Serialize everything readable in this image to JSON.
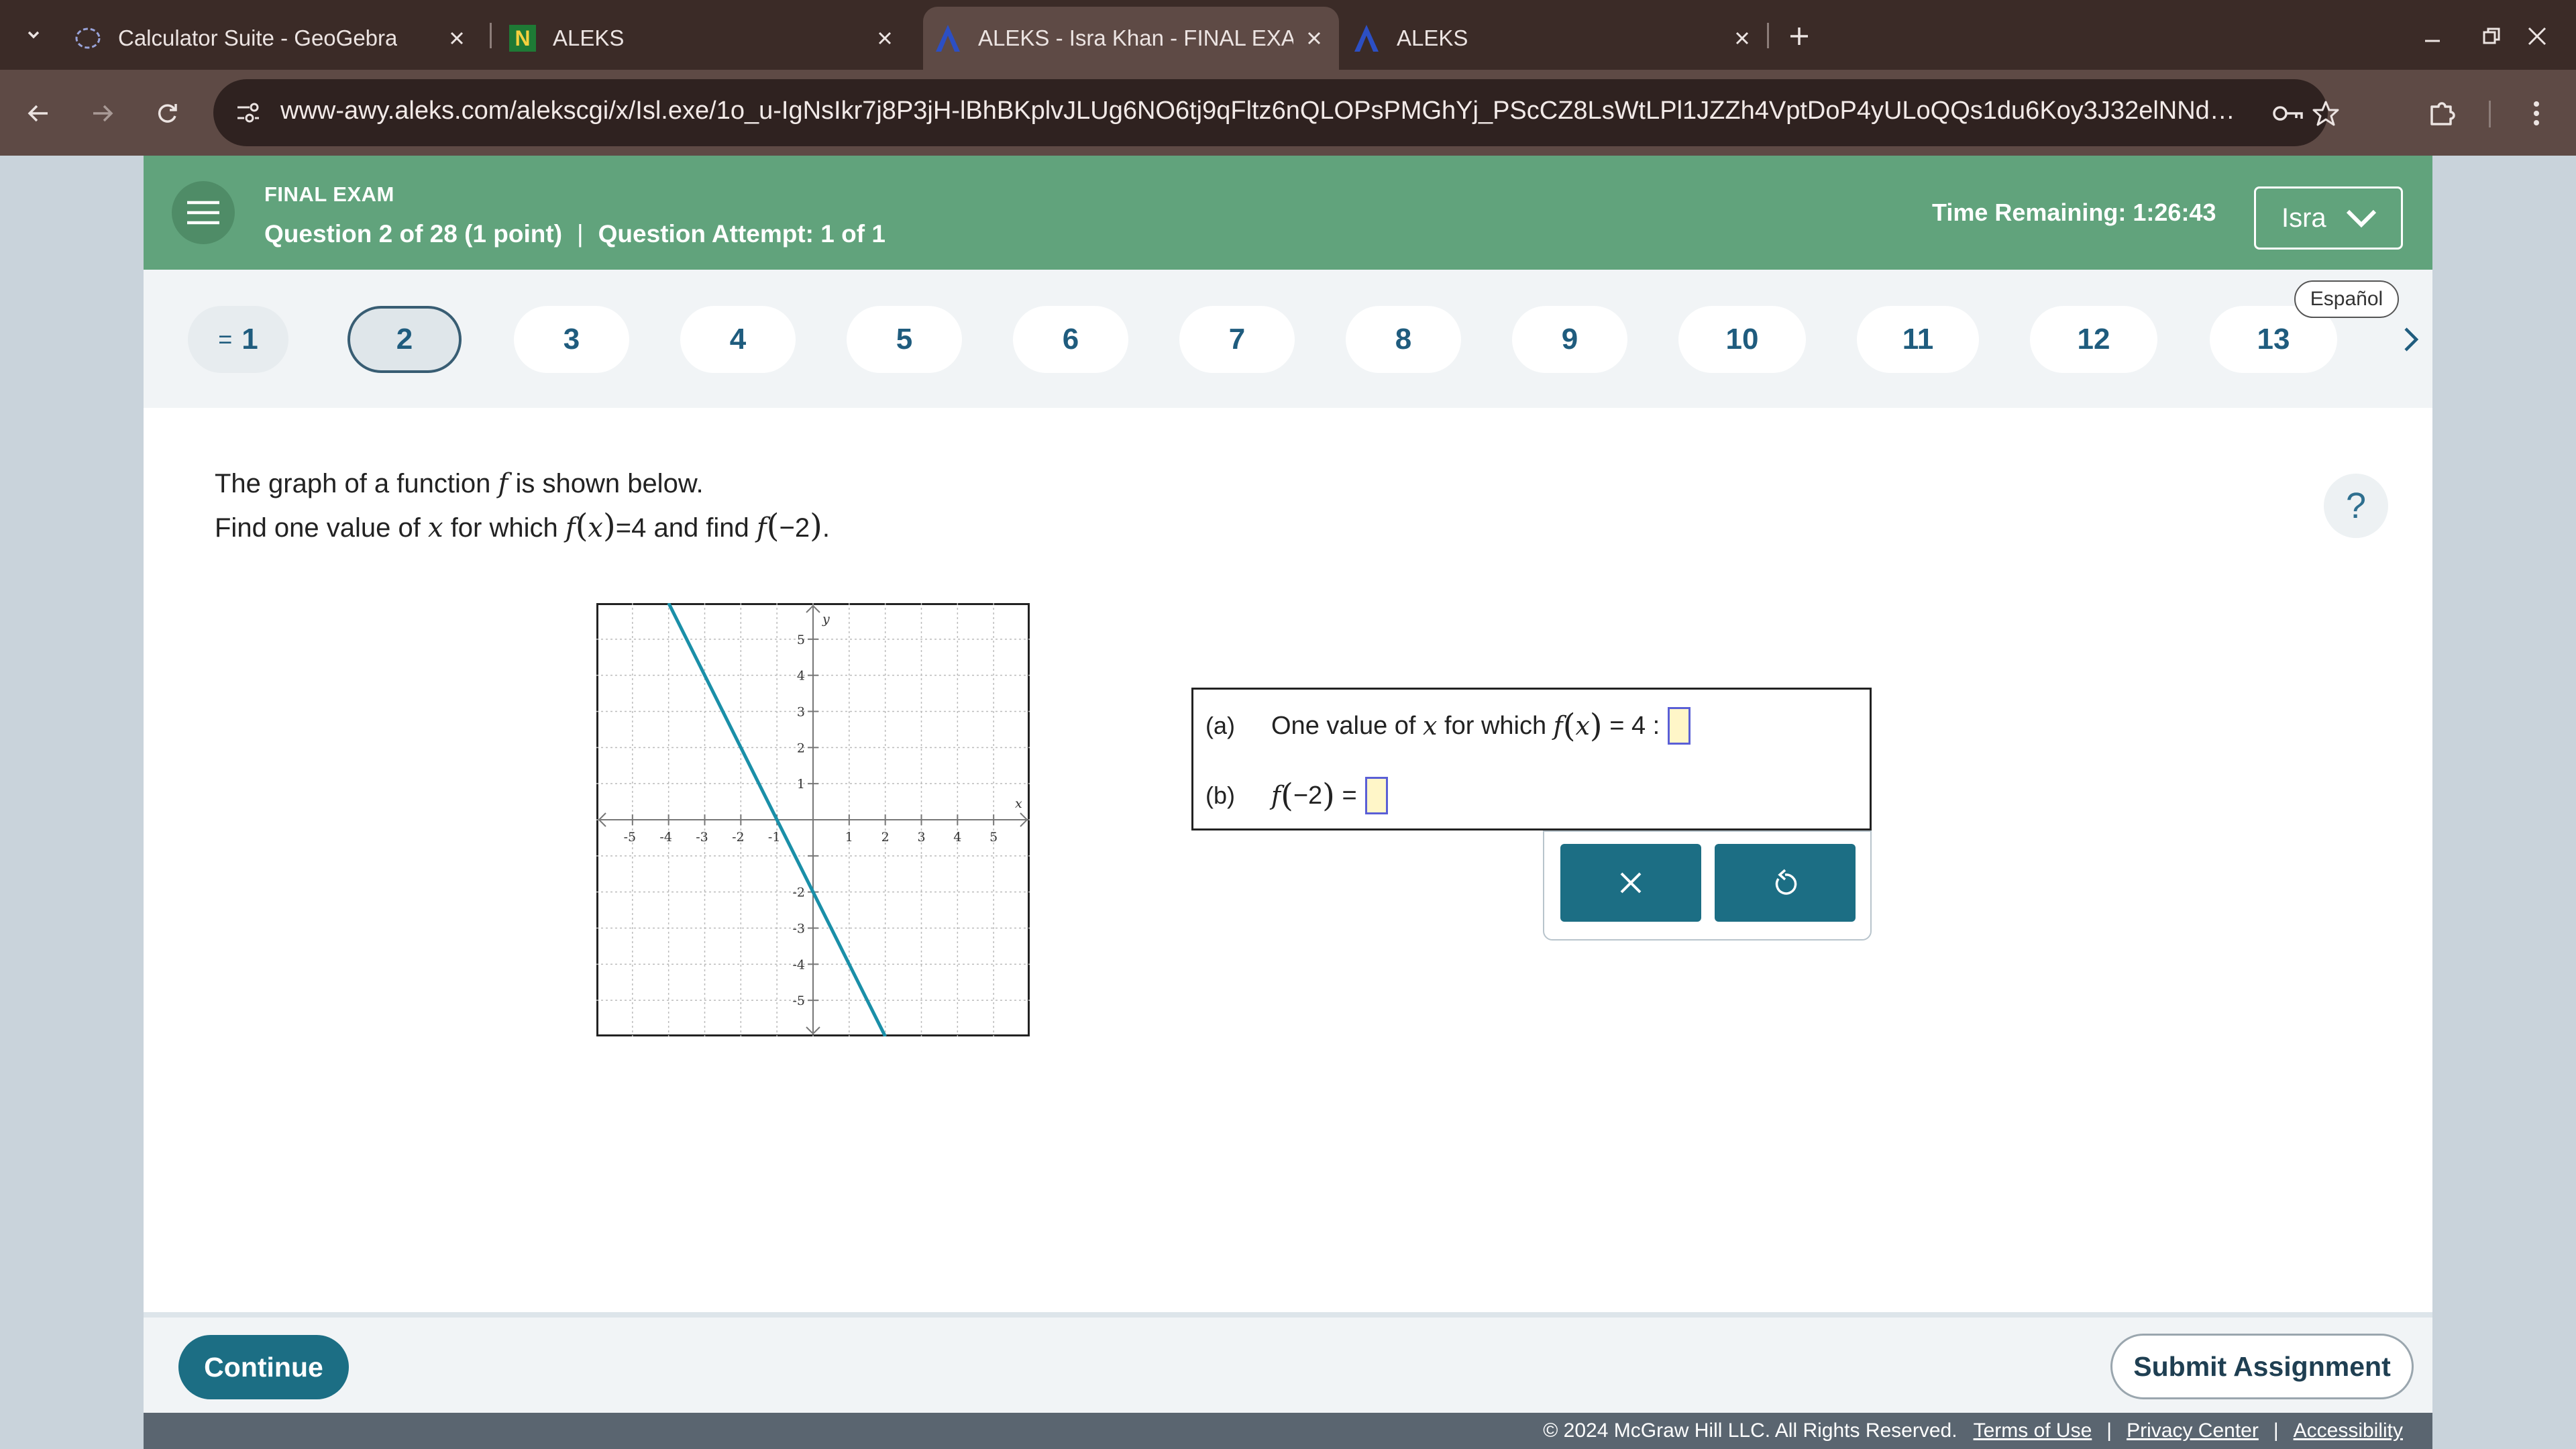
{
  "browser": {
    "tabs": [
      {
        "title": "Calculator Suite - GeoGebra",
        "icon": "geogebra-icon"
      },
      {
        "title": "ALEKS",
        "icon": "n-icon"
      },
      {
        "title": "ALEKS - Isra Khan - FINAL EXAM",
        "icon": "aleks-icon",
        "active": true
      },
      {
        "title": "ALEKS",
        "icon": "aleks-icon"
      }
    ],
    "url": "www-awy.aleks.com/alekscgi/x/Isl.exe/1o_u-IgNsIkr7j8P3jH-lBhBKplvJLUg6NO6tj9qFltz6nQLOPsPMGhYj_PScCZ8LsWtLPl1JZZh4VptDoP4yULoQQs1du6Koy3J32elNNd1bk4A..."
  },
  "header": {
    "title": "FINAL EXAM",
    "question_info": "Question 2 of 28 (1 point)",
    "attempt_info": "Question Attempt: 1 of 1",
    "separator": "|",
    "time_remaining": "Time Remaining: 1:26:43",
    "user": "Isra"
  },
  "qnav": {
    "items": [
      "1",
      "2",
      "3",
      "4",
      "5",
      "6",
      "7",
      "8",
      "9",
      "10",
      "11",
      "12",
      "13"
    ],
    "current": "2",
    "language_button": "Español"
  },
  "question": {
    "line1_a": "The graph of a function",
    "line1_b": "is shown below.",
    "line2_a": "Find one value of",
    "line2_b": "for which",
    "line2_c": "and find",
    "f": "f",
    "x": "x",
    "eq4": "=4",
    "neg2": "−2",
    "period": "."
  },
  "graph": {
    "x_label": "x",
    "y_label": "y",
    "x_ticks": [
      "-5",
      "-4",
      "-3",
      "-2",
      "-1",
      "1",
      "2",
      "3",
      "4",
      "5"
    ],
    "y_ticks": [
      "5",
      "4",
      "3",
      "2",
      "1",
      "-2",
      "-3",
      "-4",
      "-5"
    ],
    "xlim": [
      -6,
      6
    ],
    "ylim": [
      -6,
      6
    ],
    "line": {
      "slope": -2,
      "intercept": -2,
      "color": "#1a8fa8"
    }
  },
  "answers": {
    "a_label": "(a)",
    "a_text": "One value of",
    "a_for_which": "for which",
    "a_eq": "= 4 :",
    "b_label": "(b)",
    "b_neg2": "−2",
    "b_eq": "="
  },
  "footer": {
    "continue": "Continue",
    "submit": "Submit Assignment",
    "copyright": "© 2024 McGraw Hill LLC. All Rights Reserved.",
    "terms": "Terms of Use",
    "privacy": "Privacy Center",
    "accessibility": "Accessibility",
    "sep": "|"
  },
  "colors": {
    "header_green": "#61a37c",
    "primary_teal": "#1c6e84",
    "graph_line": "#1a8fa8",
    "input_fill": "#fff6c8"
  }
}
